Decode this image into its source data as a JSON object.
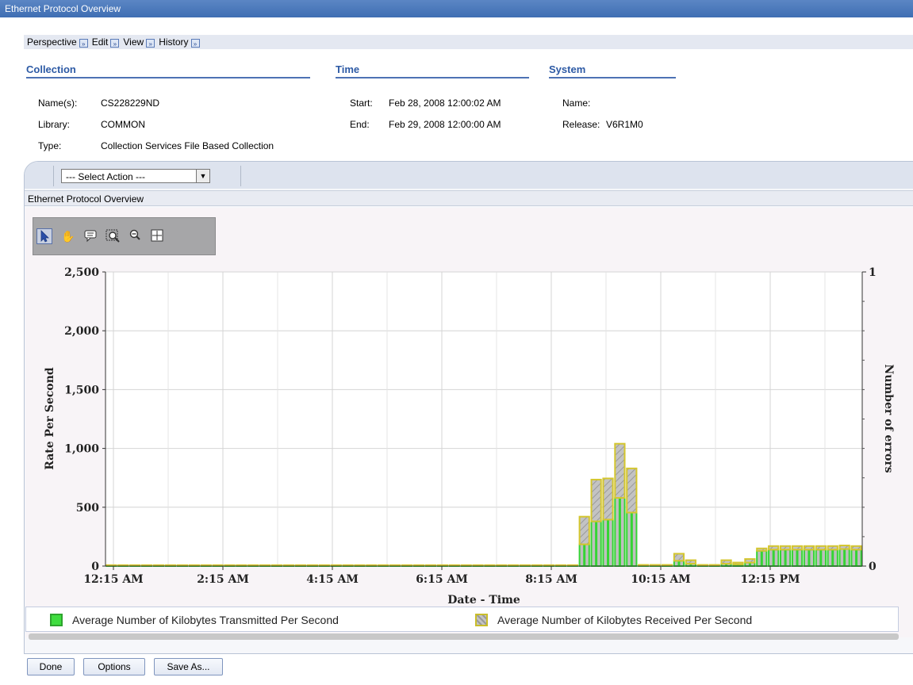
{
  "window": {
    "title": "Ethernet Protocol Overview"
  },
  "menu": [
    {
      "label": "Perspective"
    },
    {
      "label": "Edit"
    },
    {
      "label": "View"
    },
    {
      "label": "History"
    }
  ],
  "collection": {
    "heading": "Collection",
    "names_label": "Name(s):",
    "names_value": "CS228229ND",
    "library_label": "Library:",
    "library_value": "COMMON",
    "type_label": "Type:",
    "type_value": "Collection Services File Based Collection"
  },
  "time": {
    "heading": "Time",
    "start_label": "Start:",
    "start_value": "Feb 28, 2008 12:00:02 AM",
    "end_label": "End:",
    "end_value": "Feb 29, 2008 12:00:00 AM"
  },
  "system": {
    "heading": "System",
    "name_label": "Name:",
    "name_value": "",
    "release_label": "Release:",
    "release_value": "V6R1M0"
  },
  "action_select": {
    "value": "--- Select Action ---"
  },
  "panel_title": "Ethernet Protocol Overview",
  "tools": [
    "select-arrow-icon",
    "pan-hand-icon",
    "annotation-icon",
    "zoom-box-icon",
    "zoom-out-icon",
    "crosshair-icon"
  ],
  "chart_data": {
    "type": "bar",
    "stacked": true,
    "xlabel": "Date - Time",
    "ylabel": "Rate Per Second",
    "y2label": "Number of errors",
    "ylim": [
      0,
      2500
    ],
    "y2lim": [
      0,
      1
    ],
    "yticks": [
      "0",
      "500",
      "1,000",
      "1,500",
      "2,000",
      "2,500"
    ],
    "y2ticks": [
      "0",
      "1"
    ],
    "xticks": [
      "12:15 AM",
      "2:15 AM",
      "4:15 AM",
      "6:15 AM",
      "8:15 AM",
      "10:15 AM",
      "12:15 PM"
    ],
    "grid": true,
    "legend_position": "bottom",
    "series": [
      {
        "name": "Average Number of Kilobytes Transmitted Per Second",
        "color": "#3fdd3f",
        "values": [
          5,
          5,
          5,
          5,
          5,
          5,
          5,
          5,
          5,
          5,
          5,
          5,
          5,
          5,
          5,
          5,
          5,
          5,
          5,
          5,
          5,
          5,
          5,
          5,
          5,
          5,
          5,
          5,
          5,
          5,
          5,
          5,
          5,
          5,
          5,
          5,
          5,
          5,
          5,
          5,
          185,
          380,
          395,
          580,
          455,
          5,
          5,
          5,
          45,
          20,
          5,
          5,
          20,
          15,
          30,
          130,
          140,
          140,
          140,
          140,
          140,
          140,
          145,
          140
        ]
      },
      {
        "name": "Average Number of Kilobytes Received Per Second",
        "color": "#d9cc3a",
        "values": [
          3,
          3,
          3,
          3,
          3,
          3,
          3,
          3,
          3,
          3,
          3,
          3,
          3,
          3,
          3,
          3,
          3,
          3,
          3,
          3,
          3,
          3,
          3,
          3,
          3,
          3,
          3,
          3,
          3,
          3,
          3,
          3,
          3,
          3,
          3,
          3,
          3,
          3,
          3,
          3,
          235,
          355,
          350,
          460,
          375,
          5,
          5,
          5,
          60,
          30,
          5,
          5,
          30,
          15,
          30,
          20,
          30,
          30,
          30,
          30,
          30,
          30,
          30,
          30
        ]
      }
    ]
  },
  "buttons": {
    "done": "Done",
    "options": "Options",
    "save_as": "Save As..."
  }
}
